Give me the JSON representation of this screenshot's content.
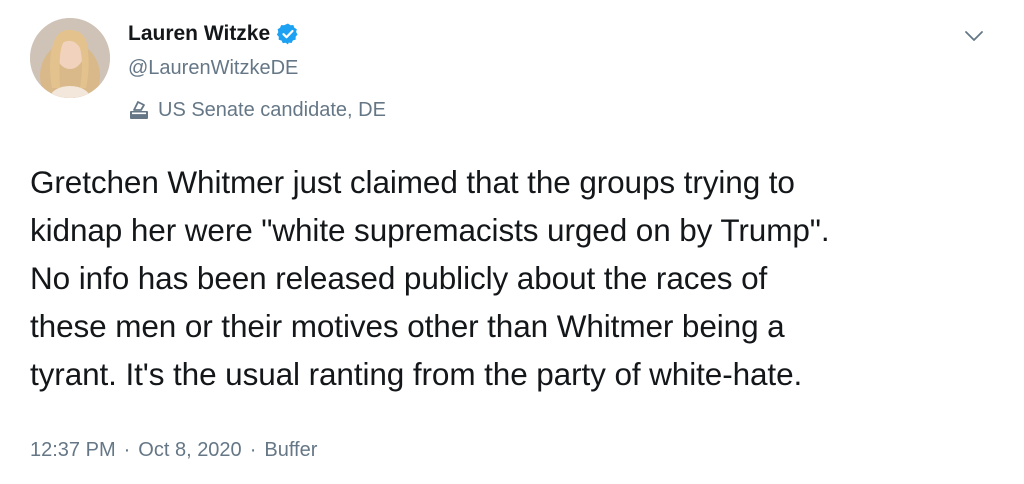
{
  "author": {
    "display_name": "Lauren Witzke",
    "handle": "@LaurenWitzkeDE",
    "verified": true,
    "label": "US Senate candidate, DE",
    "label_icon": "ballot-box-icon"
  },
  "tweet": {
    "lines": [
      "Gretchen Whitmer just claimed that the groups trying to",
      "kidnap her were \"white supremacists urged on by Trump\".",
      "No info has been released publicly about the races of",
      "these men or their motives other than Whitmer being a",
      "tyrant. It's the usual ranting from the party of white-hate."
    ]
  },
  "meta": {
    "time": "12:37 PM",
    "separator": "·",
    "date": "Oct 8, 2020",
    "source": "Buffer"
  },
  "colors": {
    "text": "#14171a",
    "secondary": "#657786",
    "verified": "#1da1f2"
  }
}
